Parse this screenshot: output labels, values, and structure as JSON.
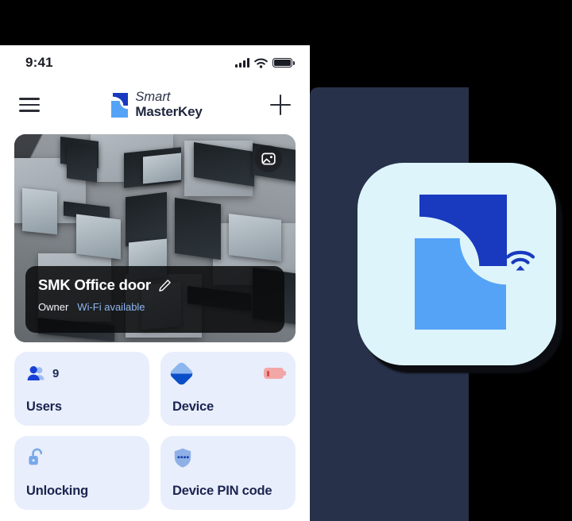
{
  "statusbar": {
    "time": "9:41",
    "signal_icon": "cellular-signal-icon",
    "wifi_icon": "wifi-icon",
    "battery_icon": "battery-full-icon"
  },
  "navbar": {
    "menu_icon": "hamburger-menu-icon",
    "add_icon": "plus-icon",
    "brand_line1": "Smart",
    "brand_line2": "MasterKey",
    "brand_mark_icon": "smart-masterkey-logo-icon"
  },
  "hero": {
    "photo_button_icon": "image-placeholder-icon",
    "door_name": "SMK Office door",
    "edit_icon": "pencil-edit-icon",
    "role": "Owner",
    "connection": "Wi-Fi available"
  },
  "tiles": [
    {
      "label": "Users",
      "icon": "users-group-icon",
      "count": "9"
    },
    {
      "label": "Device",
      "icon": "device-diamond-icon",
      "badge_icon": "low-battery-icon"
    },
    {
      "label": "Unlocking",
      "icon": "open-padlock-icon"
    },
    {
      "label": "Device PIN code",
      "icon": "shield-pin-icon"
    }
  ],
  "app_icon": {
    "name": "smart-masterkey-app-icon",
    "wifi_icon": "wifi-icon",
    "background": "#ddf4fb",
    "mark_dark": "#1939bf",
    "mark_light": "#54a3f7"
  },
  "theme": {
    "page_background": "#000000",
    "panel_navy": "#273149",
    "tile_background": "#e8eefb",
    "text_navy": "#1b2450",
    "accent_blue": "#1939bf",
    "accent_light_blue": "#54a3f7",
    "battery_warning": "#d94a4a"
  }
}
